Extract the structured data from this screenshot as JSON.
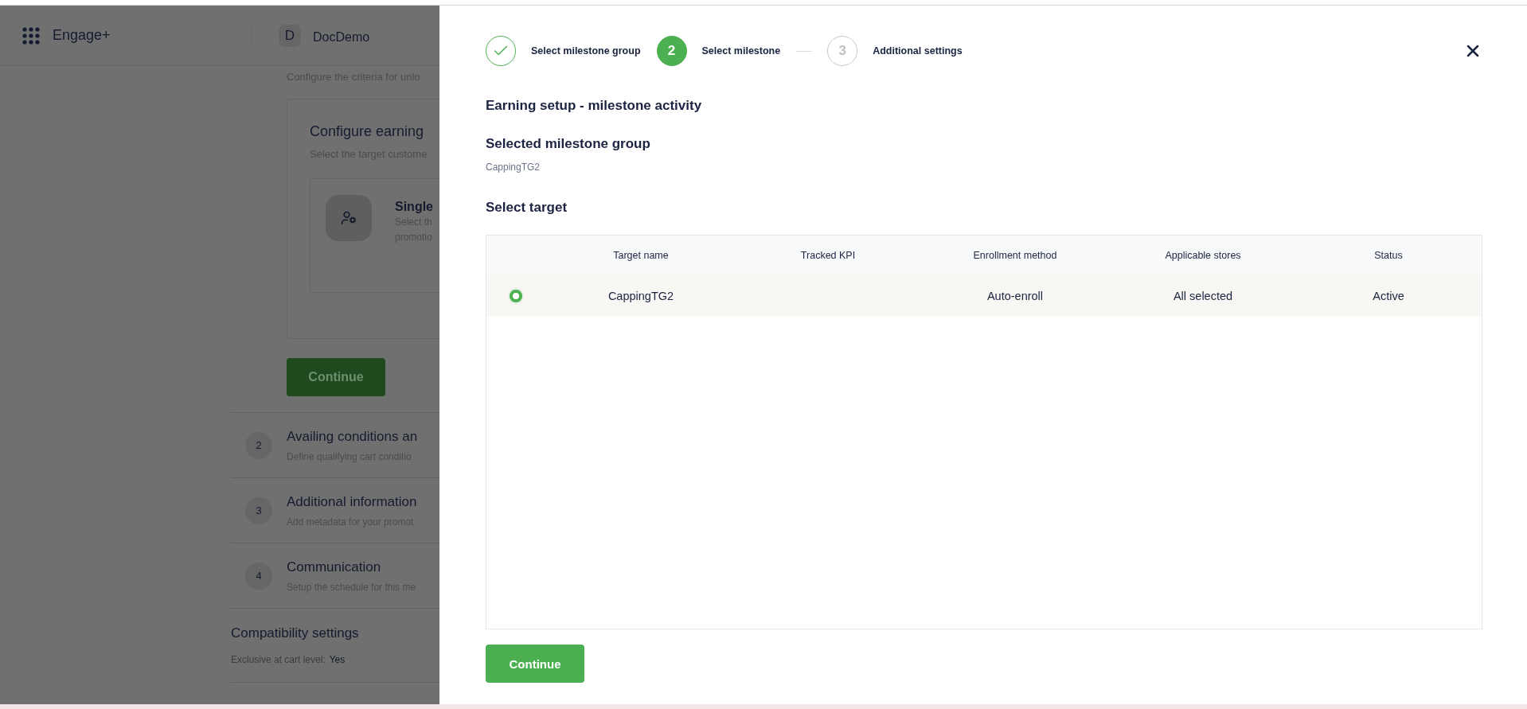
{
  "app": {
    "name": "Engage+",
    "account": {
      "initial": "D",
      "name": "DocDemo"
    }
  },
  "background": {
    "intro": "Configure the criteria for unlo",
    "card": {
      "title": "Configure earning",
      "subtitle": "Select the target custome",
      "option": {
        "title": "Single",
        "lines": [
          "Select th",
          "promotio"
        ]
      }
    },
    "continue": "Continue",
    "sections": [
      {
        "number": "2",
        "title": "Availing conditions an",
        "subtitle": "Define qualifying cart conditio"
      },
      {
        "number": "3",
        "title": "Additional information",
        "subtitle": "Add metadata for your promot"
      },
      {
        "number": "4",
        "title": "Communication",
        "subtitle": "Setup the schedule for this me"
      }
    ],
    "compatibility": {
      "title": "Compatibility settings",
      "label": "Exclusive at cart level:",
      "value": "Yes"
    }
  },
  "drawer": {
    "steps": [
      {
        "label": "Select milestone group",
        "done": true,
        "selected": false
      },
      {
        "number": "2",
        "label": "Select milestone",
        "done": false,
        "selected": true
      },
      {
        "number": "3",
        "label": "Additional settings",
        "done": false,
        "selected": false
      }
    ],
    "heading": "Earning setup - milestone activity",
    "group_title": "Selected milestone group",
    "group_value": "CappingTG2",
    "target_title": "Select target",
    "table": {
      "columns": [
        "Target name",
        "Tracked KPI",
        "Enrollment method",
        "Applicable stores",
        "Status"
      ],
      "rows": [
        {
          "selected": true,
          "cells": [
            "CappingTG2",
            null,
            "Auto-enroll",
            "All selected",
            "Active"
          ]
        }
      ]
    },
    "continue": "Continue"
  }
}
